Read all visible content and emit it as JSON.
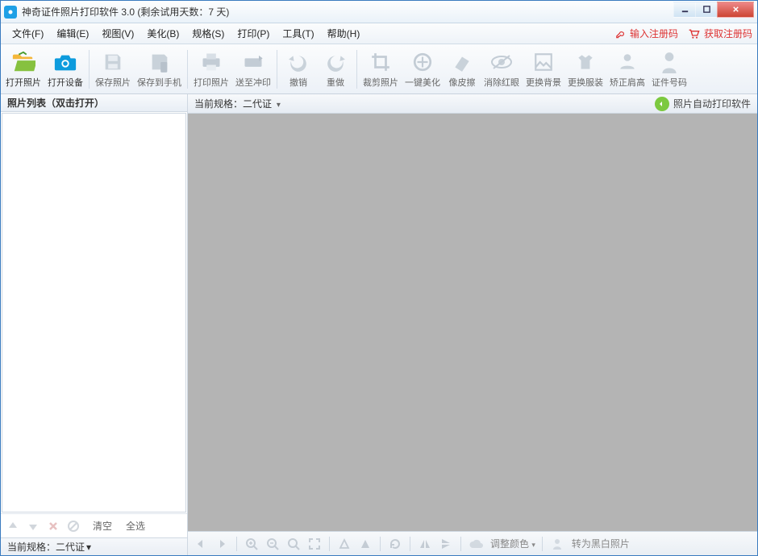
{
  "titlebar": {
    "title": "神奇证件照片打印软件 3.0 (剩余试用天数：7 天)"
  },
  "menu": {
    "file": "文件(F)",
    "edit": "编辑(E)",
    "view": "视图(V)",
    "beauty": "美化(B)",
    "spec": "规格(S)",
    "print": "打印(P)",
    "tool": "工具(T)",
    "help": "帮助(H)",
    "enter_code": "输入注册码",
    "get_code": "获取注册码"
  },
  "toolbar": {
    "open_photo": "打开照片",
    "open_device": "打开设备",
    "save_photo": "保存照片",
    "save_phone": "保存到手机",
    "print_photo": "打印照片",
    "send_print": "送至冲印",
    "undo": "撤销",
    "redo": "重做",
    "crop": "裁剪照片",
    "one_beauty": "一键美化",
    "eraser": "像皮擦",
    "redeye": "消除红眼",
    "bg": "更换背景",
    "clothes": "更换服装",
    "shoulder": "矫正肩高",
    "id_number": "证件号码"
  },
  "left": {
    "header": "照片列表（双击打开）",
    "clear": "清空",
    "select_all": "全选",
    "status_label": "当前规格：",
    "status_value": "二代证"
  },
  "right": {
    "spec_label": "当前规格：",
    "spec_value": "二代证",
    "auto_print": "照片自动打印软件",
    "adjust_color": "调整颜色",
    "to_bw": "转为黑白照片"
  }
}
